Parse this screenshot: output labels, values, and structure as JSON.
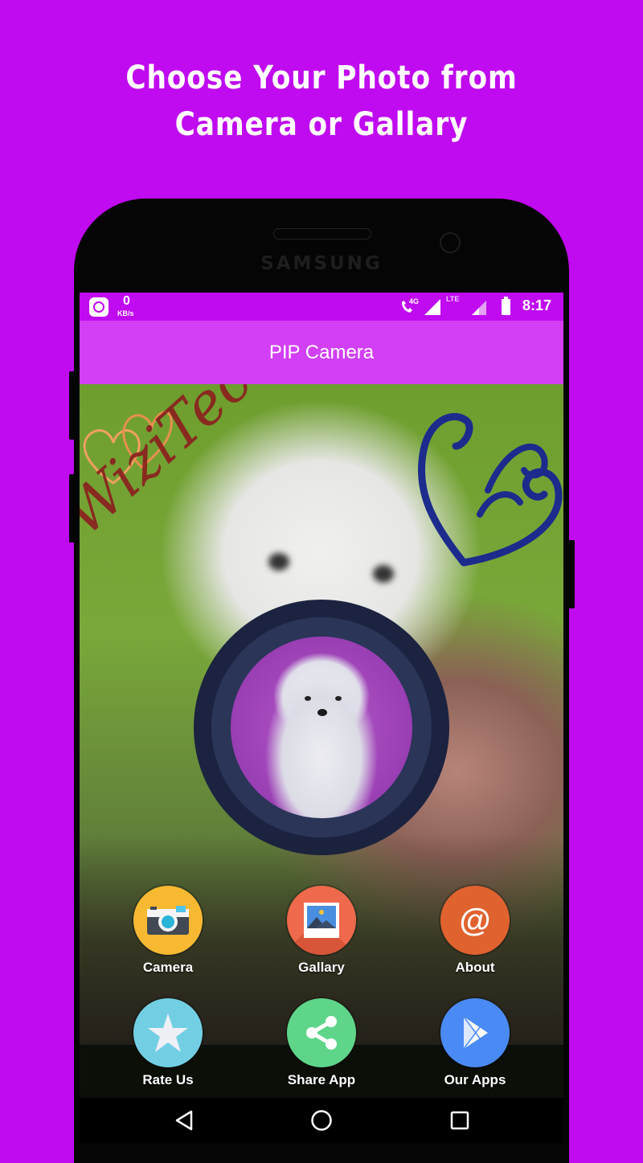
{
  "promo": {
    "line1": "Choose Your Photo from",
    "line2": "Camera or Gallary"
  },
  "device": {
    "brand": "SAMSUNG"
  },
  "statusbar": {
    "speed_value": "0",
    "speed_unit": "KB/s",
    "network_label": "4G",
    "lte_label": "LTE",
    "time": "8:17",
    "icons": [
      "speed-meter-icon",
      "volte-call-icon",
      "signal-icon",
      "lte-icon",
      "signal-weak-icon",
      "battery-icon"
    ]
  },
  "appbar": {
    "title": "PIP Camera"
  },
  "watermark": {
    "text": "WiziTech",
    "color": "#8b1e1e"
  },
  "menu": {
    "items": [
      {
        "label": "Camera",
        "icon": "camera-icon",
        "color": "#f8b932"
      },
      {
        "label": "Gallary",
        "icon": "gallery-icon",
        "color": "#ef6a4c"
      },
      {
        "label": "About",
        "icon": "at-icon",
        "color": "#e0622e"
      },
      {
        "label": "Rate Us",
        "icon": "star-icon",
        "color": "#72cfe3"
      },
      {
        "label": "Share App",
        "icon": "share-icon",
        "color": "#5fd58a"
      },
      {
        "label": "Our Apps",
        "icon": "play-store-icon",
        "color": "#4a8af4"
      }
    ]
  },
  "navbar": {
    "icons": [
      "back-icon",
      "home-icon",
      "recents-icon"
    ]
  },
  "colors": {
    "background": "#c00af0",
    "statusbar": "#c00af0",
    "appbar": "#d23ff5"
  }
}
